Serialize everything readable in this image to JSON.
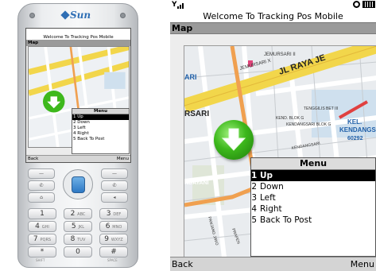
{
  "phone": {
    "brand": "Sun",
    "mini_screen": {
      "title": "Welcome To Tracking Pos Mobile",
      "app_name": "Map",
      "menu_title": "Menu",
      "menu_items": [
        "Up",
        "Down",
        "Left",
        "Right",
        "Back To Post"
      ],
      "soft_left": "Back",
      "soft_right": "Menu"
    },
    "keys": {
      "row1": [
        "1",
        "2",
        "3"
      ],
      "row1_sub": [
        "",
        "ABC",
        "DEF"
      ],
      "row2": [
        "4",
        "5",
        "6"
      ],
      "row2_sub": [
        "GHI",
        "JKL",
        "MNO"
      ],
      "row3": [
        "7",
        "8",
        "9"
      ],
      "row3_sub": [
        "PQRS",
        "TUV",
        "WXYZ"
      ],
      "row4": [
        "*",
        "0",
        "#"
      ],
      "row4_sub": [
        "",
        "",
        ""
      ],
      "under_left": "SHIFT",
      "under_right": "SPACE"
    }
  },
  "screen": {
    "title": "Welcome To Tracking Pos Mobile",
    "app_name": "Map",
    "map_labels": {
      "l1": "JEMURSARI II",
      "l2": "JEMURSARI X",
      "l3": "JL RAYA JE",
      "l4": "TENGGILIS BET III",
      "l5": "KEND. BLOK G",
      "l6": "KENDANGSARI BLOK G",
      "l7": "KEL.",
      "l8": "KENDANGSA",
      "l9": "60292",
      "l10": "KENDANGSARI",
      "l11": "RSARI",
      "l12": "NDAYANI",
      "l13": "ARI",
      "l14": "PRAPEN",
      "l15": "PANJANG JIWO"
    },
    "menu": {
      "title": "Menu",
      "items": [
        {
          "num": "1",
          "label": "Up",
          "selected": true
        },
        {
          "num": "2",
          "label": "Down",
          "selected": false
        },
        {
          "num": "3",
          "label": "Left",
          "selected": false
        },
        {
          "num": "4",
          "label": "Right",
          "selected": false
        },
        {
          "num": "5",
          "label": "Back To Post",
          "selected": false
        }
      ]
    },
    "soft_left": "Back",
    "soft_right": "Menu"
  },
  "colors": {
    "app_bar": "#9a9a9a",
    "soft_bar": "#d4d4d4",
    "menu_selected": "#000000",
    "pin_green": "#3db81c",
    "map_road_yellow": "#f2d64b",
    "map_road_orange": "#f0a050",
    "map_water": "#cfe0ee"
  }
}
